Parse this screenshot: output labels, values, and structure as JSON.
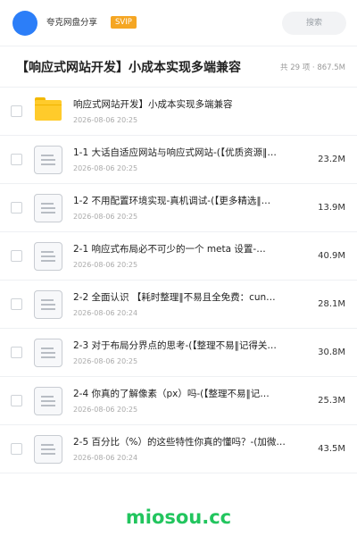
{
  "header": {
    "app_name": "夸克网盘分享",
    "badge": "SVIP",
    "search_placeholder": "搜索"
  },
  "folder": {
    "title": "【响应式网站开发】小成本实现多端兼容",
    "meta": "共 29 项 · 867.5M"
  },
  "files": [
    {
      "name": "响应式网站开发】小成本实现多端兼容",
      "date": "2026-08-06 20:25",
      "size": "",
      "icon": "folder-icon"
    },
    {
      "name": "1-1 大话自适应网站与响应式网站-(【优质资源‖…",
      "date": "2026-08-06 20:25",
      "size": "23.2M",
      "icon": "document-icon"
    },
    {
      "name": "1-2 不用配置环境实现-真机调试-(【更多精选‖…",
      "date": "2026-08-06 20:25",
      "size": "13.9M",
      "icon": "document-icon"
    },
    {
      "name": "2-1 响应式布局必不可少的一个 meta 设置-…",
      "date": "2026-08-06 20:25",
      "size": "40.9M",
      "icon": "document-icon"
    },
    {
      "name": "2-2 全面认识 【耗时整理‖不易且全免费：cun…",
      "date": "2026-08-06 20:24",
      "size": "28.1M",
      "icon": "document-icon"
    },
    {
      "name": "2-3 对于布局分界点的思考-(【整理不易‖记得关…",
      "date": "2026-08-06 20:25",
      "size": "30.8M",
      "icon": "document-icon"
    },
    {
      "name": "2-4 你真的了解像素（px）吗-(【整理不易‖记…",
      "date": "2026-08-06 20:25",
      "size": "25.3M",
      "icon": "document-icon"
    },
    {
      "name": "2-5 百分比（%）的这些特性你真的懂吗？-(加微…",
      "date": "2026-08-06 20:24",
      "size": "43.5M",
      "icon": "document-icon"
    }
  ],
  "watermark": "miosou.cc",
  "colors": {
    "avatar": "#2c7ef8",
    "badge": "#f5a623",
    "folder": "#ffcb2b",
    "watermark": "#22c55e"
  }
}
